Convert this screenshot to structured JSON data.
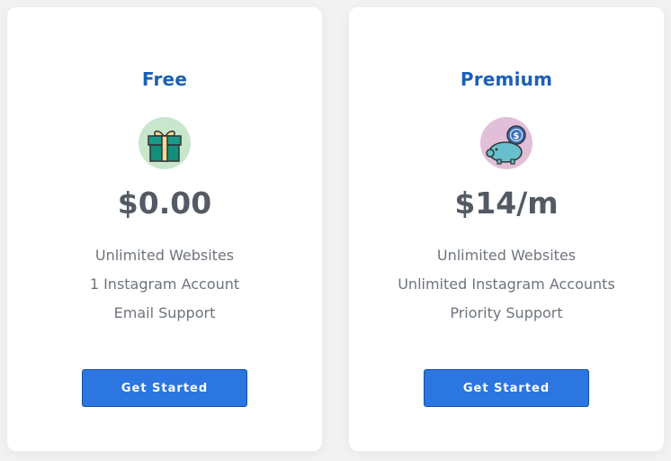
{
  "plans": [
    {
      "name": "Free",
      "icon": "gift-icon",
      "price": "$0.00",
      "features": [
        "Unlimited Websites",
        "1 Instagram Account",
        "Email Support"
      ],
      "cta_label": "Get Started"
    },
    {
      "name": "Premium",
      "icon": "piggy-bank-icon",
      "price": "$14/m",
      "features": [
        "Unlimited Websites",
        "Unlimited Instagram Accounts",
        "Priority Support"
      ],
      "cta_label": "Get Started"
    }
  ],
  "colors": {
    "background": "#f2f2f3",
    "card": "#ffffff",
    "plan_name": "#1b5fb7",
    "price": "#535a63",
    "feature_text": "#6e747c",
    "button": "#2b76e0",
    "button_border": "#1650a5"
  }
}
